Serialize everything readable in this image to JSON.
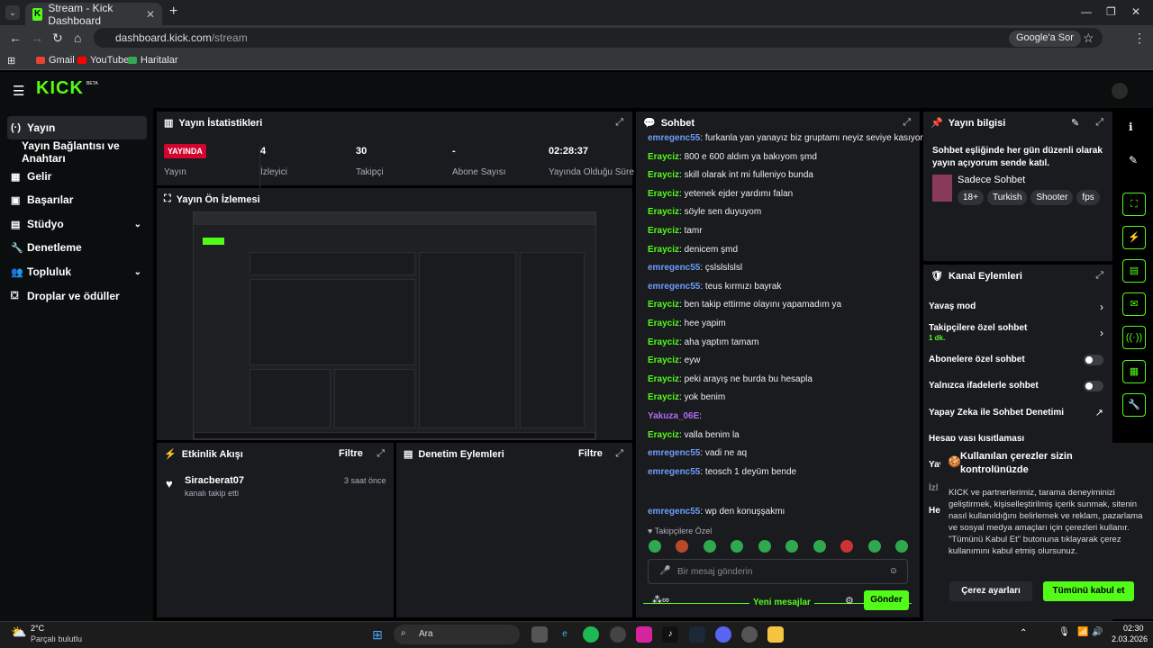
{
  "browser": {
    "tab_title": "Stream - Kick Dashboard",
    "url_host": "dashboard.kick.com",
    "url_path": "/stream",
    "google_sor": "Google'a Sor",
    "bookmarks": [
      "Gmail",
      "YouTube",
      "Haritalar"
    ]
  },
  "brand": {
    "logo": "KICK",
    "beta": "BETA",
    "accent": "#53fc18"
  },
  "sidebar": {
    "items": [
      {
        "label": "Yayın",
        "icon": "(·)"
      },
      {
        "label": "Yayın Bağlantısı ve Anahtarı",
        "icon": ""
      },
      {
        "label": "Gelir",
        "icon": "▦"
      },
      {
        "label": "Başarılar",
        "icon": "▣"
      },
      {
        "label": "Stüdyo",
        "icon": "▤"
      },
      {
        "label": "Denetleme",
        "icon": "🔧"
      },
      {
        "label": "Topluluk",
        "icon": "👥"
      },
      {
        "label": "Droplar ve ödüller",
        "icon": "⛋"
      }
    ]
  },
  "stats": {
    "title": "Yayın İstatistikleri",
    "live_badge": "YAYINDA",
    "live_label": "Yayın",
    "viewers_value": "4",
    "viewers_label": "İzleyici",
    "followers_value": "30",
    "followers_label": "Takipçi",
    "subs_value": "-",
    "subs_label": "Abone Sayısı",
    "uptime_value": "02:28:37",
    "uptime_label": "Yayında Olduğu Süre"
  },
  "preview": {
    "title": "Yayın Ön İzlemesi"
  },
  "activity": {
    "title": "Etkinlik Akışı",
    "filter": "Filtre",
    "event_user": "Siracberat07",
    "event_text": "kanalı takip etti",
    "event_time": "3 saat önce"
  },
  "moderation": {
    "title": "Denetim Eylemleri",
    "filter": "Filtre"
  },
  "chat": {
    "title": "Sohbet",
    "messages": [
      {
        "user": "emregenc55",
        "cls": "u1",
        "text": ": furkanla yan yanayız biz gruptamı neyiz seviye kasıyor"
      },
      {
        "user": "Erayciz",
        "cls": "u2",
        "text": ": 800 e 600 aldım ya bakıyom şmd"
      },
      {
        "user": "Erayciz",
        "cls": "u2",
        "text": ": skill olarak int mi fulleniyo bunda"
      },
      {
        "user": "Erayciz",
        "cls": "u2",
        "text": ": yetenek ejder yardımı falan"
      },
      {
        "user": "Erayciz",
        "cls": "u2",
        "text": ": söyle sen duyuyom"
      },
      {
        "user": "Erayciz",
        "cls": "u2",
        "text": ": tamr"
      },
      {
        "user": "Erayciz",
        "cls": "u2",
        "text": ": denicem şmd"
      },
      {
        "user": "emregenc55",
        "cls": "u1",
        "text": ": çslslslslsl"
      },
      {
        "user": "emregenc55",
        "cls": "u1",
        "text": ": teus kırmızı bayrak"
      },
      {
        "user": "Erayciz",
        "cls": "u2",
        "text": ": ben takip ettirme olayını yapamadım ya"
      },
      {
        "user": "Erayciz",
        "cls": "u2",
        "text": ": hee yapim"
      },
      {
        "user": "Erayciz",
        "cls": "u2",
        "text": ": aha yaptım tamam"
      },
      {
        "user": "Erayciz",
        "cls": "u2",
        "text": ": eyw"
      },
      {
        "user": "Erayciz",
        "cls": "u2",
        "text": ": peki arayış ne burda bu hesapla"
      },
      {
        "user": "Erayciz",
        "cls": "u2",
        "text": ": yok benim"
      },
      {
        "user": "Yakuza_06E",
        "cls": "u3",
        "text": ":"
      },
      {
        "user": "Erayciz",
        "cls": "u2",
        "text": ": valla benim la"
      },
      {
        "user": "emregenc55",
        "cls": "u1",
        "text": ": vadi ne aq"
      },
      {
        "user": "emregenc55",
        "cls": "u1",
        "text": ": teosch 1 deyüm bende"
      }
    ],
    "new_messages": "Yeni mesajlar",
    "last_user": "emregenc55",
    "last_text": ": wp den konuşşakmı",
    "followers_only": "Takipçilere Özel",
    "input_placeholder": "Bir mesaj gönderin",
    "send": "Gönder"
  },
  "stream_info": {
    "title": "Yayın bilgisi",
    "description": "Sohbet eşliğinde her gün düzenli olarak yayın açıyorum sende katıl.",
    "category": "Sadece Sohbet",
    "tags": [
      "18+",
      "Turkish",
      "Shooter",
      "fps"
    ]
  },
  "channel_actions": {
    "title": "Kanal Eylemleri",
    "slow_mode": "Yavaş mod",
    "followers_chat": "Takipçilere özel sohbet",
    "followers_chat_sub": "1 dk.",
    "subs_chat": "Abonelere özel sohbet",
    "emotes_chat": "Yalnızca ifadelerle sohbet",
    "ai_mod": "Yapay Zeka ile Sohbet Denetimi",
    "partial_1": "Hesap yaşı kısıtlaması",
    "partial_2": "Yav",
    "partial_3": "İzl",
    "partial_4": "He"
  },
  "cookie": {
    "title": "Kullanılan çerezler sizin kontrolünüzde",
    "body": "KICK ve partnerlerimiz, tarama deneyiminizi geliştirmek, kişiselleştirilmiş içerik sunmak, sitenin nasıl kullanıldığını belirlemek ve reklam, pazarlama ve sosyal medya amaçları için çerezleri kullanır. \"Tümünü Kabul Et\" butonuna tıklayarak çerez kullanımını kabul etmiş olursunuz.",
    "settings": "Çerez ayarları",
    "accept": "Tümünü kabul et"
  },
  "taskbar": {
    "temp": "2°C",
    "weather": "Parçalı bulutlu",
    "search": "Ara",
    "time": "02:30",
    "date": "2.03.2026"
  }
}
